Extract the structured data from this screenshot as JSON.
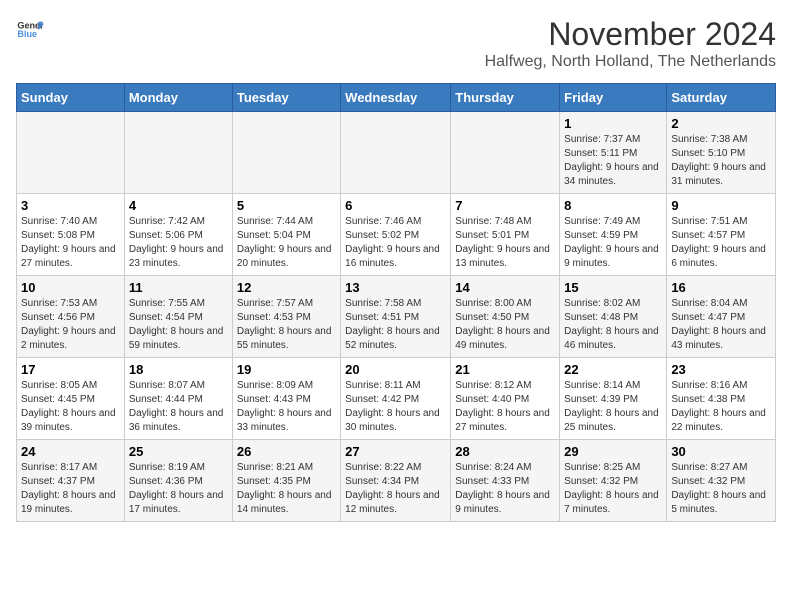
{
  "header": {
    "logo_general": "General",
    "logo_blue": "Blue",
    "title": "November 2024",
    "location": "Halfweg, North Holland, The Netherlands"
  },
  "weekdays": [
    "Sunday",
    "Monday",
    "Tuesday",
    "Wednesday",
    "Thursday",
    "Friday",
    "Saturday"
  ],
  "weeks": [
    [
      {
        "day": "",
        "info": ""
      },
      {
        "day": "",
        "info": ""
      },
      {
        "day": "",
        "info": ""
      },
      {
        "day": "",
        "info": ""
      },
      {
        "day": "",
        "info": ""
      },
      {
        "day": "1",
        "info": "Sunrise: 7:37 AM\nSunset: 5:11 PM\nDaylight: 9 hours and 34 minutes."
      },
      {
        "day": "2",
        "info": "Sunrise: 7:38 AM\nSunset: 5:10 PM\nDaylight: 9 hours and 31 minutes."
      }
    ],
    [
      {
        "day": "3",
        "info": "Sunrise: 7:40 AM\nSunset: 5:08 PM\nDaylight: 9 hours and 27 minutes."
      },
      {
        "day": "4",
        "info": "Sunrise: 7:42 AM\nSunset: 5:06 PM\nDaylight: 9 hours and 23 minutes."
      },
      {
        "day": "5",
        "info": "Sunrise: 7:44 AM\nSunset: 5:04 PM\nDaylight: 9 hours and 20 minutes."
      },
      {
        "day": "6",
        "info": "Sunrise: 7:46 AM\nSunset: 5:02 PM\nDaylight: 9 hours and 16 minutes."
      },
      {
        "day": "7",
        "info": "Sunrise: 7:48 AM\nSunset: 5:01 PM\nDaylight: 9 hours and 13 minutes."
      },
      {
        "day": "8",
        "info": "Sunrise: 7:49 AM\nSunset: 4:59 PM\nDaylight: 9 hours and 9 minutes."
      },
      {
        "day": "9",
        "info": "Sunrise: 7:51 AM\nSunset: 4:57 PM\nDaylight: 9 hours and 6 minutes."
      }
    ],
    [
      {
        "day": "10",
        "info": "Sunrise: 7:53 AM\nSunset: 4:56 PM\nDaylight: 9 hours and 2 minutes."
      },
      {
        "day": "11",
        "info": "Sunrise: 7:55 AM\nSunset: 4:54 PM\nDaylight: 8 hours and 59 minutes."
      },
      {
        "day": "12",
        "info": "Sunrise: 7:57 AM\nSunset: 4:53 PM\nDaylight: 8 hours and 55 minutes."
      },
      {
        "day": "13",
        "info": "Sunrise: 7:58 AM\nSunset: 4:51 PM\nDaylight: 8 hours and 52 minutes."
      },
      {
        "day": "14",
        "info": "Sunrise: 8:00 AM\nSunset: 4:50 PM\nDaylight: 8 hours and 49 minutes."
      },
      {
        "day": "15",
        "info": "Sunrise: 8:02 AM\nSunset: 4:48 PM\nDaylight: 8 hours and 46 minutes."
      },
      {
        "day": "16",
        "info": "Sunrise: 8:04 AM\nSunset: 4:47 PM\nDaylight: 8 hours and 43 minutes."
      }
    ],
    [
      {
        "day": "17",
        "info": "Sunrise: 8:05 AM\nSunset: 4:45 PM\nDaylight: 8 hours and 39 minutes."
      },
      {
        "day": "18",
        "info": "Sunrise: 8:07 AM\nSunset: 4:44 PM\nDaylight: 8 hours and 36 minutes."
      },
      {
        "day": "19",
        "info": "Sunrise: 8:09 AM\nSunset: 4:43 PM\nDaylight: 8 hours and 33 minutes."
      },
      {
        "day": "20",
        "info": "Sunrise: 8:11 AM\nSunset: 4:42 PM\nDaylight: 8 hours and 30 minutes."
      },
      {
        "day": "21",
        "info": "Sunrise: 8:12 AM\nSunset: 4:40 PM\nDaylight: 8 hours and 27 minutes."
      },
      {
        "day": "22",
        "info": "Sunrise: 8:14 AM\nSunset: 4:39 PM\nDaylight: 8 hours and 25 minutes."
      },
      {
        "day": "23",
        "info": "Sunrise: 8:16 AM\nSunset: 4:38 PM\nDaylight: 8 hours and 22 minutes."
      }
    ],
    [
      {
        "day": "24",
        "info": "Sunrise: 8:17 AM\nSunset: 4:37 PM\nDaylight: 8 hours and 19 minutes."
      },
      {
        "day": "25",
        "info": "Sunrise: 8:19 AM\nSunset: 4:36 PM\nDaylight: 8 hours and 17 minutes."
      },
      {
        "day": "26",
        "info": "Sunrise: 8:21 AM\nSunset: 4:35 PM\nDaylight: 8 hours and 14 minutes."
      },
      {
        "day": "27",
        "info": "Sunrise: 8:22 AM\nSunset: 4:34 PM\nDaylight: 8 hours and 12 minutes."
      },
      {
        "day": "28",
        "info": "Sunrise: 8:24 AM\nSunset: 4:33 PM\nDaylight: 8 hours and 9 minutes."
      },
      {
        "day": "29",
        "info": "Sunrise: 8:25 AM\nSunset: 4:32 PM\nDaylight: 8 hours and 7 minutes."
      },
      {
        "day": "30",
        "info": "Sunrise: 8:27 AM\nSunset: 4:32 PM\nDaylight: 8 hours and 5 minutes."
      }
    ]
  ]
}
